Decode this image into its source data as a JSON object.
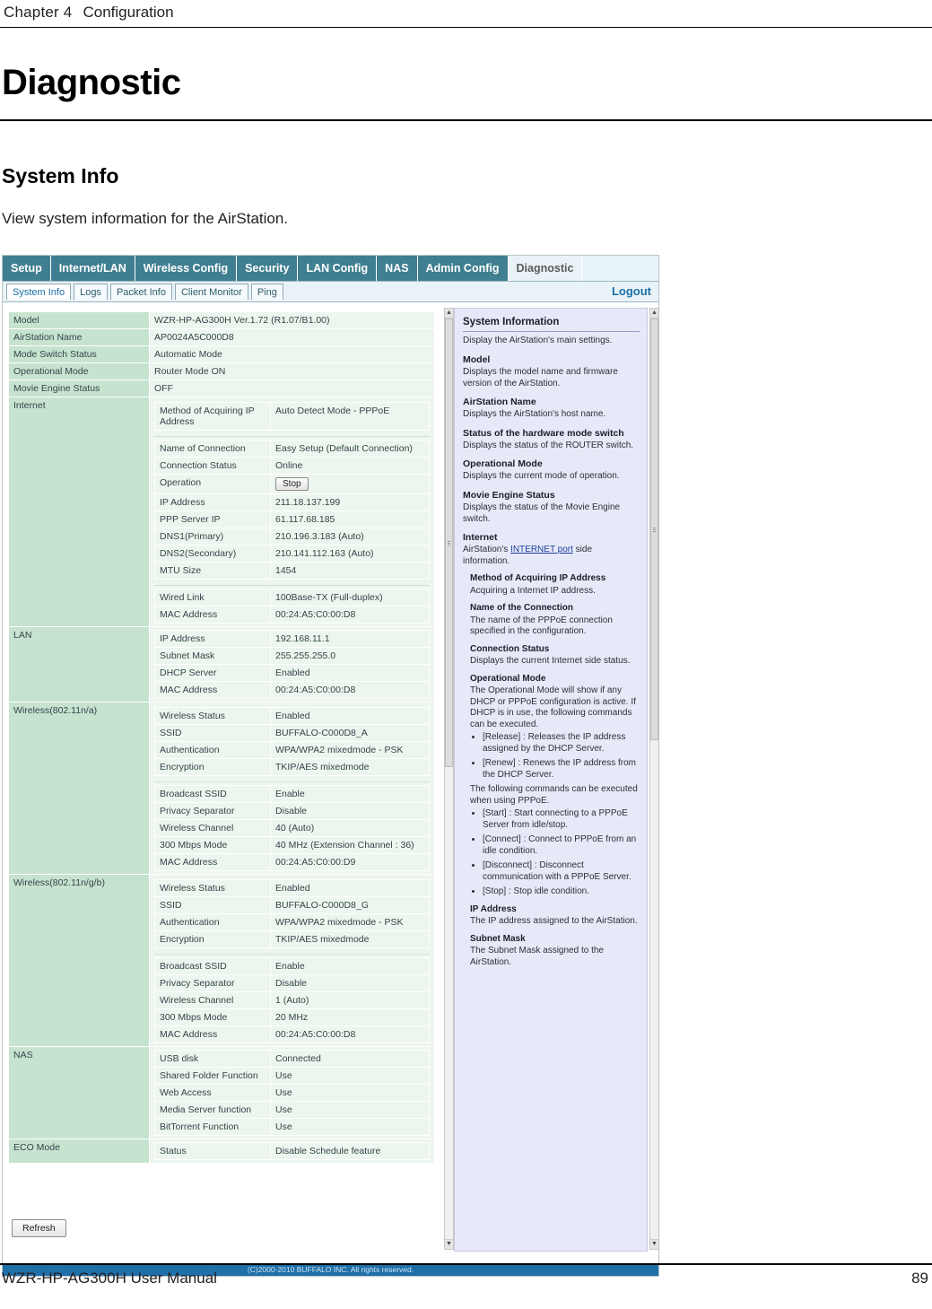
{
  "header": {
    "chapter_label": "Chapter 4",
    "chapter_title": "Configuration"
  },
  "title": "Diagnostic",
  "section": {
    "heading": "System Info",
    "description": "View system information for the AirStation."
  },
  "screenshot": {
    "nav_tabs": [
      {
        "label": "Setup",
        "active": false
      },
      {
        "label": "Internet/LAN",
        "active": false
      },
      {
        "label": "Wireless Config",
        "active": false
      },
      {
        "label": "Security",
        "active": false
      },
      {
        "label": "LAN Config",
        "active": false
      },
      {
        "label": "NAS",
        "active": false
      },
      {
        "label": "Admin Config",
        "active": false
      },
      {
        "label": "Diagnostic",
        "active": true
      }
    ],
    "sub_tabs": [
      {
        "label": "System Info",
        "active": true
      },
      {
        "label": "Logs",
        "active": false
      },
      {
        "label": "Packet Info",
        "active": false
      },
      {
        "label": "Client Monitor",
        "active": false
      },
      {
        "label": "Ping",
        "active": false
      }
    ],
    "logout_label": "Logout",
    "refresh_label": "Refresh",
    "copyright": "(C)2000-2010 BUFFALO INC. All rights reserved.",
    "rows": {
      "model": {
        "label": "Model",
        "value": "WZR-HP-AG300H Ver.1.72 (R1.07/B1.00)"
      },
      "airstation_name": {
        "label": "AirStation Name",
        "value": "AP0024A5C000D8"
      },
      "mode_switch": {
        "label": "Mode Switch Status",
        "value": "Automatic Mode"
      },
      "operational_mode": {
        "label": "Operational Mode",
        "value": "Router Mode ON"
      },
      "movie_engine": {
        "label": "Movie Engine Status",
        "value": "OFF"
      },
      "internet": {
        "label": "Internet",
        "group1": [
          {
            "k": "Method of Acquiring IP Address",
            "v": "Auto Detect Mode - PPPoE"
          }
        ],
        "group2": [
          {
            "k": "Name of Connection",
            "v": "Easy Setup (Default Connection)"
          },
          {
            "k": "Connection Status",
            "v": "Online"
          },
          {
            "k": "Operation",
            "v": "Stop",
            "button": true
          },
          {
            "k": "IP Address",
            "v": "211.18.137.199"
          },
          {
            "k": "PPP Server IP",
            "v": "61.117.68.185"
          },
          {
            "k": "DNS1(Primary)",
            "v": "210.196.3.183 (Auto)"
          },
          {
            "k": "DNS2(Secondary)",
            "v": "210.141.112.163 (Auto)"
          },
          {
            "k": "MTU Size",
            "v": "1454"
          }
        ],
        "group3": [
          {
            "k": "Wired Link",
            "v": "100Base-TX (Full-duplex)"
          },
          {
            "k": "MAC Address",
            "v": "00:24:A5:C0:00:D8"
          }
        ]
      },
      "lan": {
        "label": "LAN",
        "items": [
          {
            "k": "IP Address",
            "v": "192.168.11.1"
          },
          {
            "k": "Subnet Mask",
            "v": "255.255.255.0"
          },
          {
            "k": "DHCP Server",
            "v": "Enabled"
          },
          {
            "k": "MAC Address",
            "v": "00:24:A5:C0:00:D8"
          }
        ]
      },
      "wireless_na": {
        "label": "Wireless(802.11n/a)",
        "group1": [
          {
            "k": "Wireless Status",
            "v": "Enabled"
          },
          {
            "k": "SSID",
            "v": "BUFFALO-C000D8_A"
          },
          {
            "k": "Authentication",
            "v": "WPA/WPA2 mixedmode - PSK"
          },
          {
            "k": "Encryption",
            "v": "TKIP/AES mixedmode"
          }
        ],
        "group2": [
          {
            "k": "Broadcast SSID",
            "v": "Enable"
          },
          {
            "k": "Privacy Separator",
            "v": "Disable"
          },
          {
            "k": "Wireless Channel",
            "v": "40 (Auto)"
          },
          {
            "k": "300 Mbps Mode",
            "v": "40 MHz (Extension Channel : 36)"
          },
          {
            "k": "MAC Address",
            "v": "00:24:A5:C0:00:D9"
          }
        ]
      },
      "wireless_ngb": {
        "label": "Wireless(802.11n/g/b)",
        "group1": [
          {
            "k": "Wireless Status",
            "v": "Enabled"
          },
          {
            "k": "SSID",
            "v": "BUFFALO-C000D8_G"
          },
          {
            "k": "Authentication",
            "v": "WPA/WPA2 mixedmode - PSK"
          },
          {
            "k": "Encryption",
            "v": "TKIP/AES mixedmode"
          }
        ],
        "group2": [
          {
            "k": "Broadcast SSID",
            "v": "Enable"
          },
          {
            "k": "Privacy Separator",
            "v": "Disable"
          },
          {
            "k": "Wireless Channel",
            "v": "1 (Auto)"
          },
          {
            "k": "300 Mbps Mode",
            "v": "20 MHz"
          },
          {
            "k": "MAC Address",
            "v": "00:24:A5:C0:00:D8"
          }
        ]
      },
      "nas": {
        "label": "NAS",
        "items": [
          {
            "k": "USB disk",
            "v": "Connected"
          },
          {
            "k": "Shared Folder Function",
            "v": "Use"
          },
          {
            "k": "Web Access",
            "v": "Use"
          },
          {
            "k": "Media Server function",
            "v": "Use"
          },
          {
            "k": "BitTorrent Function",
            "v": "Use"
          }
        ]
      },
      "eco": {
        "label": "ECO Mode",
        "items": [
          {
            "k": "Status",
            "v": "Disable Schedule feature"
          }
        ]
      }
    },
    "help": {
      "title": "System Information",
      "intro": "Display the AirStation's main settings.",
      "blocks": [
        {
          "h": "Model",
          "p": "Displays the model name and firmware version of the AirStation."
        },
        {
          "h": "AirStation Name",
          "p": "Displays the AirStation's host name."
        },
        {
          "h": "Status of the hardware mode switch",
          "p": "Displays the status of the ROUTER switch."
        },
        {
          "h": "Operational Mode",
          "p": "Displays the current mode of operation."
        },
        {
          "h": "Movie Engine Status",
          "p": "Displays the status of the Movie Engine switch."
        }
      ],
      "internet_heading": "Internet",
      "internet_text_pre": "AirStation's ",
      "internet_link": "INTERNET port",
      "internet_text_post": " side information.",
      "sub_blocks": [
        {
          "h": "Method of Acquiring IP Address",
          "p": "Acquiring a Internet IP address."
        },
        {
          "h": "Name of the Connection",
          "p": "The name of the PPPoE connection specified in the configuration."
        },
        {
          "h": "Connection Status",
          "p": "Displays the current Internet side status."
        },
        {
          "h": "Operational Mode",
          "p": "The Operational Mode will show if any DHCP or PPPoE configuration is active. If DHCP is in use, the following commands can be executed."
        }
      ],
      "bullets1": [
        "[Release] : Releases the IP address assigned by the DHCP Server.",
        "[Renew] : Renews the IP address from the DHCP Server."
      ],
      "pppoe_note": "The following commands can be executed when using PPPoE.",
      "bullets2": [
        "[Start] : Start connecting to a PPPoE Server from idle/stop.",
        "[Connect] : Connect to PPPoE from an idle condition.",
        "[Disconnect] : Disconnect communication with a PPPoE Server.",
        "[Stop] : Stop idle condition."
      ],
      "tail_blocks": [
        {
          "h": "IP Address",
          "p": "The IP address assigned to the AirStation."
        },
        {
          "h": "Subnet Mask",
          "p": "The Subnet Mask assigned to the AirStation."
        }
      ]
    }
  },
  "footer": {
    "left": "WZR-HP-AG300H User Manual",
    "right": "89"
  }
}
